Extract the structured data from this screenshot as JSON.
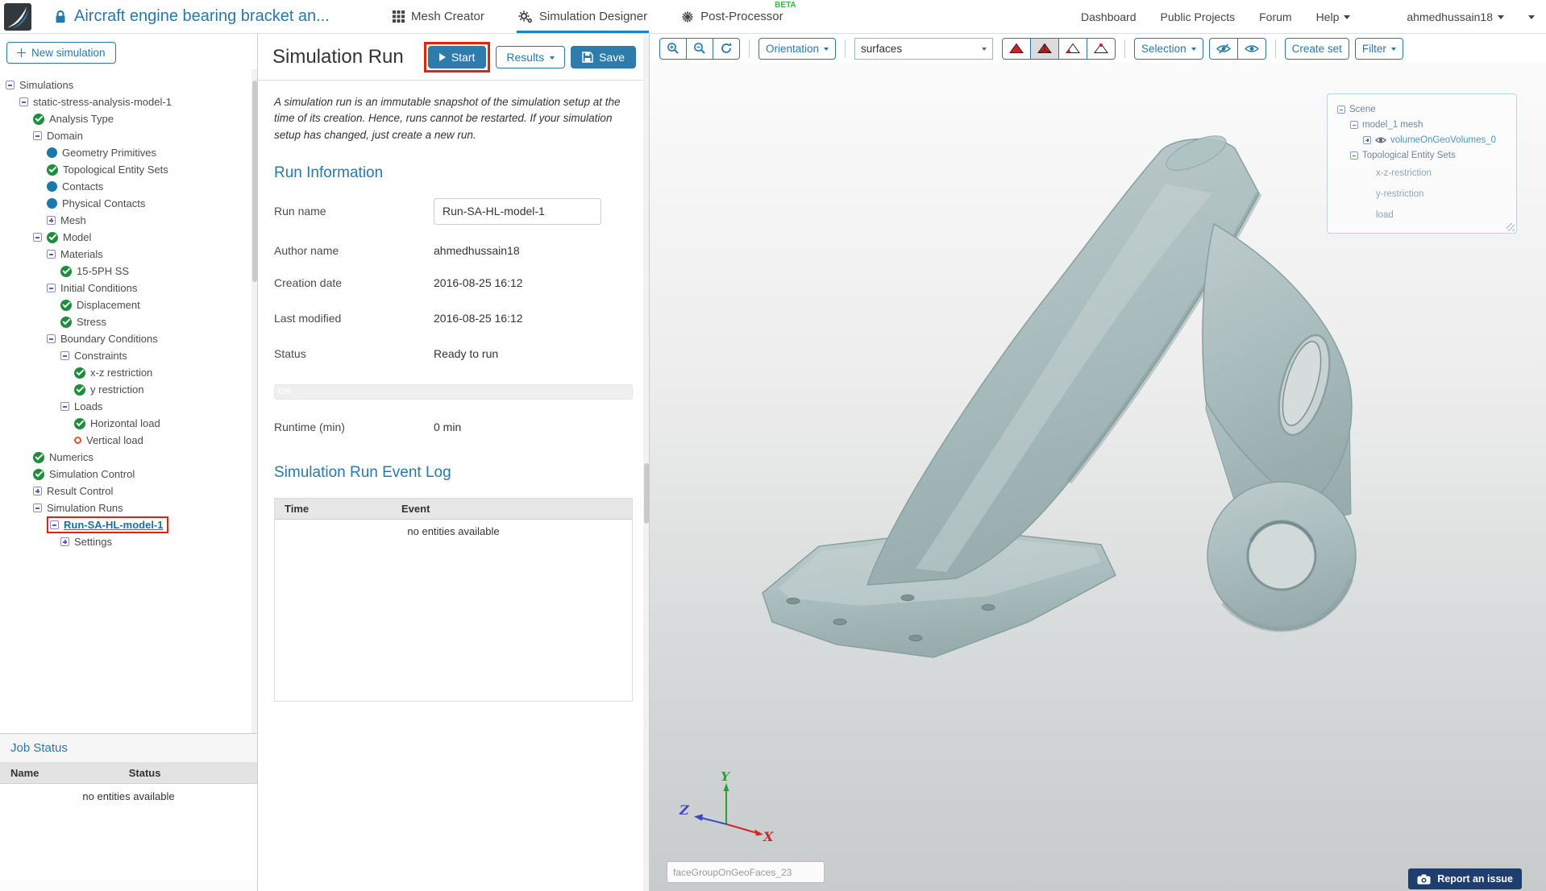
{
  "header": {
    "project_title": "Aircraft engine bearing bracket an...",
    "nav": [
      {
        "label": "Mesh Creator"
      },
      {
        "label": "Simulation Designer"
      },
      {
        "label": "Post-Processor",
        "badge": "BETA"
      }
    ],
    "links": {
      "dashboard": "Dashboard",
      "public_projects": "Public Projects",
      "forum": "Forum",
      "help": "Help"
    },
    "user": "ahmedhussain18"
  },
  "sidebar": {
    "new_simulation": "New simulation",
    "tree": [
      {
        "label": "Simulations"
      },
      {
        "label": "static-stress-analysis-model-1"
      },
      {
        "label": "Analysis Type"
      },
      {
        "label": "Domain"
      },
      {
        "label": "Geometry Primitives"
      },
      {
        "label": "Topological Entity Sets"
      },
      {
        "label": "Contacts"
      },
      {
        "label": "Physical Contacts"
      },
      {
        "label": "Mesh"
      },
      {
        "label": "Model"
      },
      {
        "label": "Materials"
      },
      {
        "label": "15-5PH SS"
      },
      {
        "label": "Initial Conditions"
      },
      {
        "label": "Displacement"
      },
      {
        "label": "Stress"
      },
      {
        "label": "Boundary Conditions"
      },
      {
        "label": "Constraints"
      },
      {
        "label": "x-z restriction"
      },
      {
        "label": "y restriction"
      },
      {
        "label": "Loads"
      },
      {
        "label": "Horizontal load"
      },
      {
        "label": "Vertical load"
      },
      {
        "label": "Numerics"
      },
      {
        "label": "Simulation Control"
      },
      {
        "label": "Result Control"
      },
      {
        "label": "Simulation Runs"
      },
      {
        "label": "Run-SA-HL-model-1"
      },
      {
        "label": "Settings"
      }
    ],
    "job_status": {
      "title": "Job Status",
      "col_name": "Name",
      "col_status": "Status",
      "empty": "no entities available"
    }
  },
  "run_panel": {
    "title": "Simulation Run",
    "start": "Start",
    "results": "Results",
    "save": "Save",
    "description": "A simulation run is an immutable snapshot of the simulation setup at the time of its creation. Hence, runs cannot be restarted. If your simulation setup has changed, just create a new run.",
    "info_heading": "Run Information",
    "run_name_label": "Run name",
    "run_name_value": "Run-SA-HL-model-1",
    "author_label": "Author name",
    "author_value": "ahmedhussain18",
    "created_label": "Creation date",
    "created_value": "2016-08-25 16:12",
    "modified_label": "Last modified",
    "modified_value": "2016-08-25 16:12",
    "status_label": "Status",
    "status_value": "Ready to run",
    "progress": "0%",
    "runtime_label": "Runtime (min)",
    "runtime_value": "0 min",
    "log_heading": "Simulation Run Event Log",
    "log_col_time": "Time",
    "log_col_event": "Event",
    "log_empty": "no entities available"
  },
  "viewport": {
    "toolbar": {
      "orientation": "Orientation",
      "render_mode_value": "surfaces",
      "selection": "Selection",
      "create_set": "Create set",
      "filter": "Filter"
    },
    "scene_tree": {
      "scene": "Scene",
      "mesh": "model_1 mesh",
      "volume": "volumeOnGeoVolumes_0",
      "topo": "Topological Entity Sets",
      "set1": "x-z-restriction",
      "set2": "y-restriction",
      "set3": "load"
    },
    "axis": {
      "x": "X",
      "y": "Y",
      "z": "Z"
    },
    "face_group_value": "faceGroupOnGeoFaces_23",
    "report_issue": "Report an issue"
  },
  "colors": {
    "accent": "#2779ab",
    "beta_green": "#3db54a",
    "check_green": "#1e8e3e",
    "dot_blue": "#1a79a8",
    "warn_red": "#e25031",
    "highlight_red": "#e8210b",
    "model_teal": "#a7bcbd",
    "report_bg": "#1d3e6e"
  }
}
